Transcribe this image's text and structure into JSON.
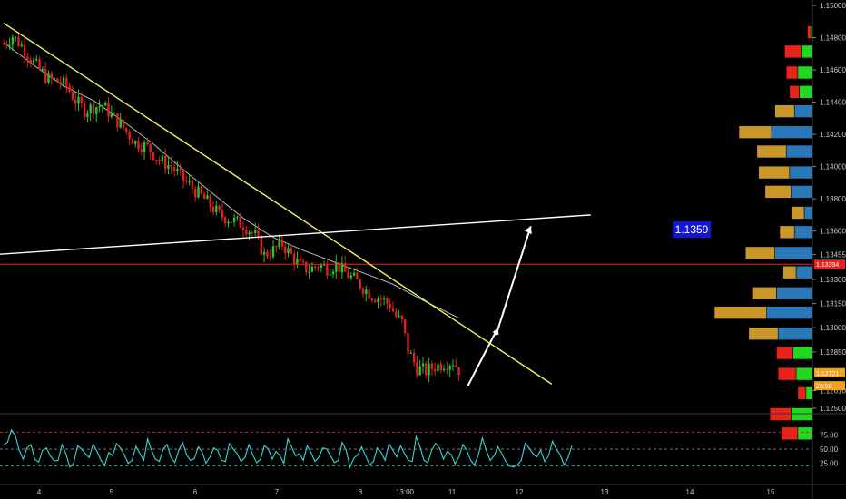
{
  "chart_data": {
    "type": "candlestick",
    "instrument_hint": "price chart with volume profile and oscillator",
    "price_axis": {
      "ticks": [
        "1.15000",
        "1.14800",
        "1.14600",
        "1.14400",
        "1.14200",
        "1.14000",
        "1.13800",
        "1.13600",
        "1.13455",
        "1.13300",
        "1.13150",
        "1.13000",
        "1.12850",
        "1.12610",
        "1.12500"
      ],
      "ylim": [
        1.125,
        1.15
      ]
    },
    "price_tags": [
      {
        "label": "1.13394",
        "value": 1.13394,
        "color": "#e8231c"
      },
      {
        "label": "1.12721",
        "value": 1.12721,
        "color": "#f2a11f"
      },
      {
        "label": "26:58",
        "value": 1.1264,
        "color": "#f2a11f"
      }
    ],
    "date_ticks": [
      "4",
      "5",
      "6",
      "7",
      "8",
      "13:00",
      "11",
      "12",
      "13",
      "14",
      "15"
    ],
    "horizontal_line": {
      "value": 1.13394,
      "color": "#e8231c"
    },
    "trendlines": [
      {
        "name": "",
        "color": "#f2f261",
        "from": {
          "bar": 0,
          "price": 1.1489
        },
        "to": {
          "bar": 183,
          "price": 1.1265
        }
      },
      {
        "name": "",
        "color": "#ffffff",
        "from": {
          "bar": -6,
          "price": 1.1345
        },
        "to": {
          "bar": 196,
          "price": 1.137
        }
      }
    ],
    "annotation": {
      "text": "1.1359",
      "bg": "#1515d4"
    },
    "arrow": {
      "color": "#ffffff",
      "from": {
        "bar": 155,
        "price": 1.1264
      },
      "to": {
        "bar": 176,
        "price": 1.1363
      }
    },
    "kinked_arrow": {
      "color": "#ffffff",
      "points": [
        {
          "bar": 155,
          "price": 1.1264
        },
        {
          "bar": 165,
          "price": 1.13
        }
      ]
    },
    "moving_average": {
      "color": "#b8b8b8",
      "points": [
        [
          0,
          1.1477
        ],
        [
          10,
          1.1463
        ],
        [
          20,
          1.145
        ],
        [
          30,
          1.1441
        ],
        [
          40,
          1.1428
        ],
        [
          50,
          1.1414
        ],
        [
          60,
          1.1398
        ],
        [
          70,
          1.1383
        ],
        [
          80,
          1.1368
        ],
        [
          90,
          1.1356
        ],
        [
          100,
          1.1348
        ],
        [
          110,
          1.1341
        ],
        [
          120,
          1.1334
        ],
        [
          130,
          1.1327
        ],
        [
          140,
          1.1317
        ],
        [
          152,
          1.1306
        ]
      ]
    },
    "candle_points": [
      [
        0,
        1.1476
      ],
      [
        3,
        1.1481
      ],
      [
        6,
        1.1475
      ],
      [
        9,
        1.1467
      ],
      [
        12,
        1.146
      ],
      [
        15,
        1.1454
      ],
      [
        18,
        1.1453
      ],
      [
        21,
        1.145
      ],
      [
        24,
        1.1441
      ],
      [
        27,
        1.1435
      ],
      [
        30,
        1.1437
      ],
      [
        33,
        1.1438
      ],
      [
        36,
        1.1432
      ],
      [
        40,
        1.1424
      ],
      [
        44,
        1.1415
      ],
      [
        48,
        1.1412
      ],
      [
        52,
        1.1404
      ],
      [
        56,
        1.14
      ],
      [
        60,
        1.1392
      ],
      [
        64,
        1.1385
      ],
      [
        68,
        1.1378
      ],
      [
        72,
        1.137
      ],
      [
        76,
        1.1367
      ],
      [
        80,
        1.1364
      ],
      [
        84,
        1.1357
      ],
      [
        87,
        1.1345
      ],
      [
        90,
        1.1348
      ],
      [
        93,
        1.1352
      ],
      [
        96,
        1.1345
      ],
      [
        99,
        1.1338
      ],
      [
        102,
        1.1336
      ],
      [
        105,
        1.1339
      ],
      [
        108,
        1.1337
      ],
      [
        111,
        1.1339
      ],
      [
        114,
        1.1334
      ],
      [
        117,
        1.133
      ],
      [
        120,
        1.1325
      ],
      [
        123,
        1.132
      ],
      [
        126,
        1.1318
      ],
      [
        129,
        1.1314
      ],
      [
        131,
        1.1307
      ],
      [
        133,
        1.1303
      ],
      [
        135,
        1.1286
      ],
      [
        138,
        1.1275
      ],
      [
        141,
        1.1273
      ],
      [
        144,
        1.1276
      ],
      [
        147,
        1.1278
      ],
      [
        150,
        1.1279
      ],
      [
        152,
        1.1274
      ]
    ],
    "volume_profile": [
      {
        "price": 1.1487,
        "buy": 2,
        "sell": 4
      },
      {
        "price": 1.1475,
        "buy": 14,
        "sell": 20
      },
      {
        "price": 1.1462,
        "buy": 18,
        "sell": 14
      },
      {
        "price": 1.145,
        "buy": 16,
        "sell": 12
      },
      {
        "price": 1.1438,
        "buy": 22,
        "sell": 24
      },
      {
        "price": 1.1425,
        "buy": 50,
        "sell": 40
      },
      {
        "price": 1.1413,
        "buy": 32,
        "sell": 36
      },
      {
        "price": 1.14,
        "buy": 28,
        "sell": 38
      },
      {
        "price": 1.1388,
        "buy": 26,
        "sell": 32
      },
      {
        "price": 1.1375,
        "buy": 10,
        "sell": 16
      },
      {
        "price": 1.1363,
        "buy": 22,
        "sell": 18
      },
      {
        "price": 1.135,
        "buy": 46,
        "sell": 36
      },
      {
        "price": 1.1338,
        "buy": 20,
        "sell": 16
      },
      {
        "price": 1.1325,
        "buy": 44,
        "sell": 30
      },
      {
        "price": 1.1313,
        "buy": 56,
        "sell": 64
      },
      {
        "price": 1.13,
        "buy": 42,
        "sell": 36
      },
      {
        "price": 1.1288,
        "buy": 24,
        "sell": 20
      },
      {
        "price": 1.1275,
        "buy": 20,
        "sell": 22
      },
      {
        "price": 1.1263,
        "buy": 8,
        "sell": 10
      },
      {
        "price": 1.125,
        "buy": 26,
        "sell": 26
      },
      {
        "price": 1.1238,
        "buy": 18,
        "sell": 20
      }
    ],
    "oscillator": {
      "color": "#37d6d6",
      "ticks": [
        "75.00",
        "50.00",
        "25.00"
      ],
      "levels": [
        {
          "value": 80,
          "color": "#cc2222"
        },
        {
          "value": 50,
          "color": "#777777"
        },
        {
          "value": 20,
          "color": "#2aa876"
        }
      ],
      "ylim": [
        0,
        100
      ],
      "values": [
        58,
        62,
        84,
        74,
        48,
        32,
        52,
        58,
        32,
        27,
        48,
        52,
        38,
        29,
        30,
        58,
        42,
        18,
        25,
        56,
        50,
        42,
        35,
        59,
        46,
        30,
        22,
        44,
        38,
        60,
        52,
        40,
        25,
        30,
        55,
        42,
        30,
        68,
        48,
        32,
        28,
        50,
        58,
        35,
        26,
        48,
        62,
        40,
        30,
        33,
        54,
        45,
        25,
        36,
        52,
        48,
        30,
        28,
        60,
        50,
        42,
        28,
        35,
        58,
        40,
        26,
        32,
        56,
        50,
        32,
        46,
        38,
        25,
        68,
        54,
        38,
        42,
        30,
        56,
        44,
        28,
        36,
        52,
        50,
        38,
        26,
        30,
        62,
        48,
        18,
        34,
        40,
        54,
        38,
        22,
        28,
        52,
        44,
        30,
        60,
        48,
        36,
        56,
        42,
        30,
        28,
        72,
        54,
        30,
        26,
        48,
        60,
        52,
        32,
        46,
        40,
        24,
        36,
        58,
        48,
        30,
        22,
        40,
        70,
        48,
        30,
        38,
        54,
        42,
        28,
        20,
        18,
        22,
        30,
        60,
        52,
        42,
        36,
        48,
        28,
        38,
        64,
        50,
        40,
        22,
        34,
        56
      ]
    }
  }
}
